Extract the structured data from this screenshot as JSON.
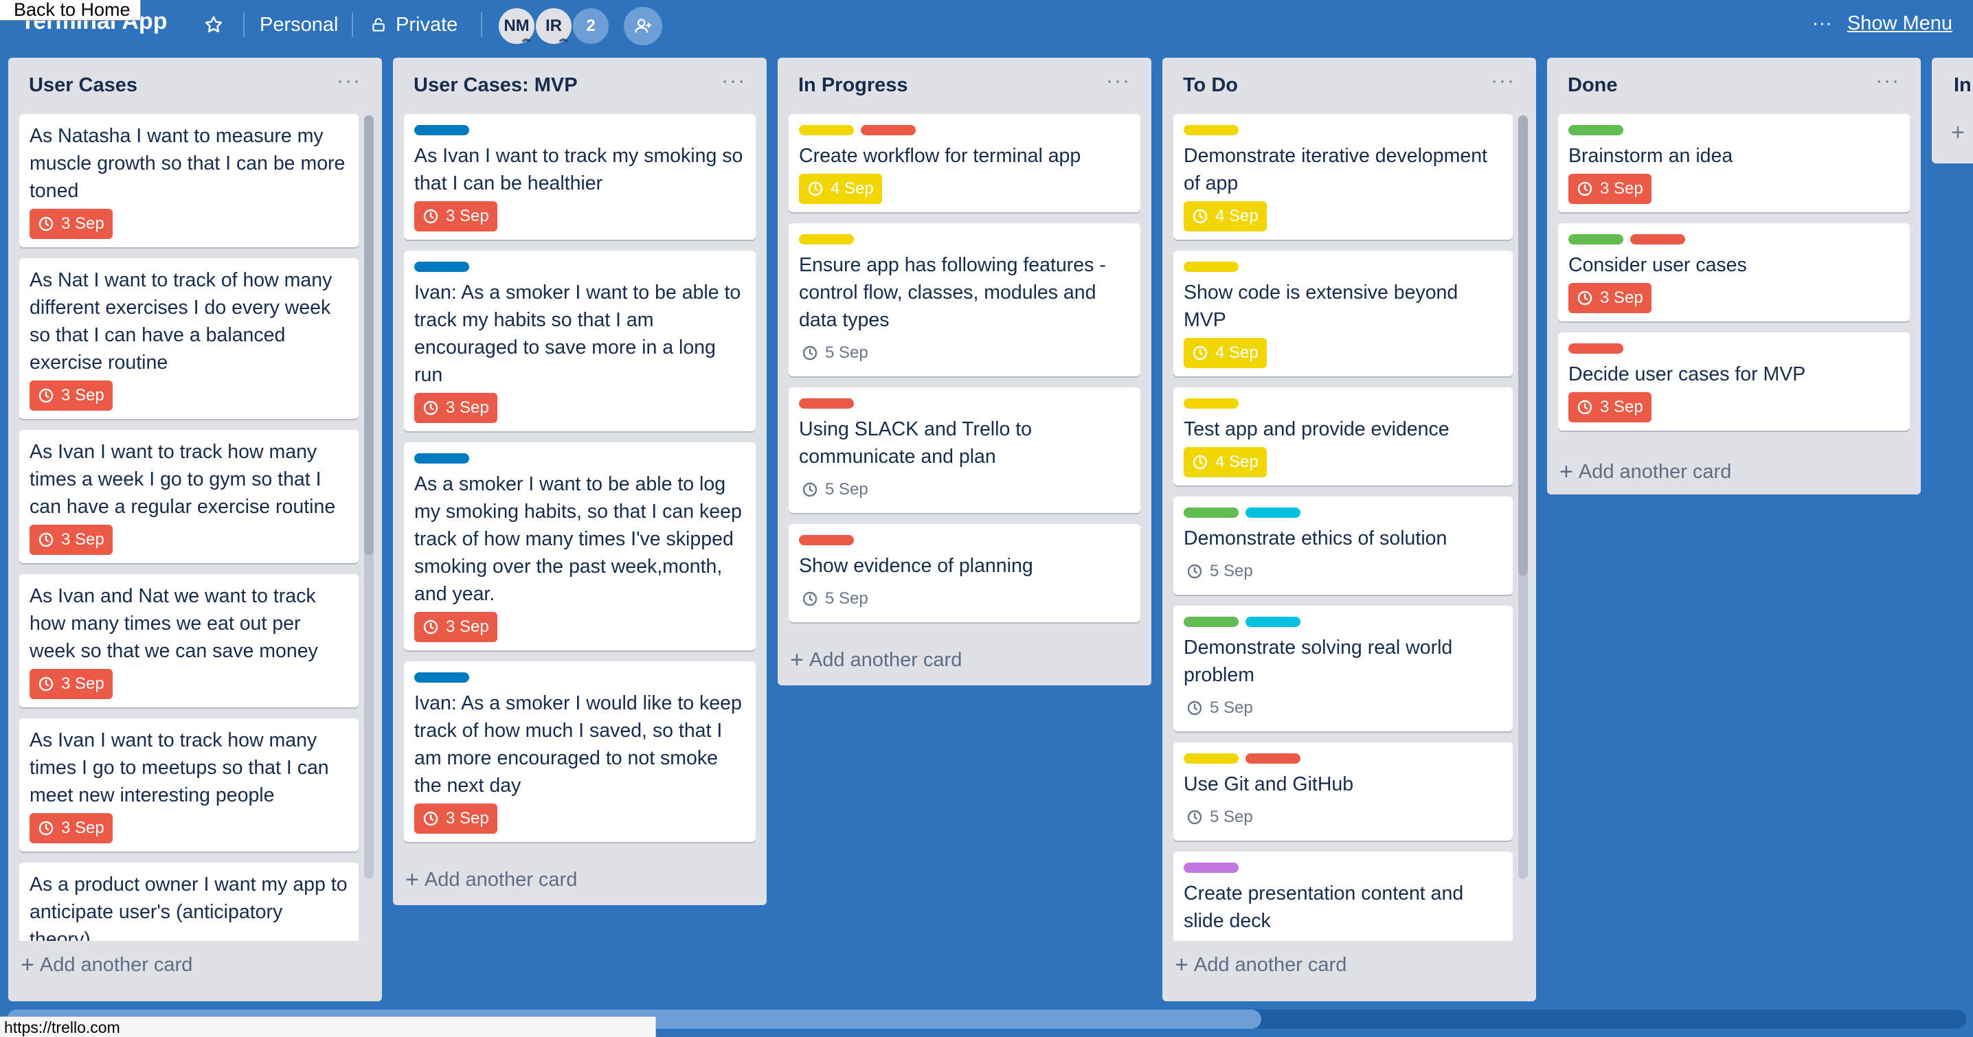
{
  "header": {
    "back_home": "Back to Home",
    "board_title": "Terminal App",
    "team": "Personal",
    "visibility": "Private",
    "members": [
      "NM",
      "IR"
    ],
    "member_count": "2",
    "show_menu_dots": "···",
    "show_menu": "Show Menu"
  },
  "colors": {
    "background": "#2f73bd",
    "red": "#eb5a46",
    "yellow": "#f2d600",
    "green": "#61bd4f",
    "blue": "#0079bf",
    "sky": "#00c2e0",
    "purple": "#c377e0"
  },
  "lists": [
    {
      "title": "User Cases",
      "menu": "···",
      "cards": [
        {
          "labels": [],
          "text": "As Natasha I want to measure my muscle growth so that I can be more toned",
          "due": "3 Sep",
          "due_style": "overdue"
        },
        {
          "labels": [],
          "text": "As Nat I want to track of how many different exercises I do every week so that I can have a balanced exercise routine",
          "due": "3 Sep",
          "due_style": "overdue"
        },
        {
          "labels": [],
          "text": "As Ivan I want to track how many times a week I go to gym so that I can have a regular exercise routine",
          "due": "3 Sep",
          "due_style": "overdue"
        },
        {
          "labels": [],
          "text": "As Ivan and Nat we want to track how many times we eat out per week so that we can save money",
          "due": "3 Sep",
          "due_style": "overdue"
        },
        {
          "labels": [],
          "text": "As Ivan I want to track how many times I go to meetups so that I can meet new interesting people",
          "due": "3 Sep",
          "due_style": "overdue"
        },
        {
          "labels": [],
          "text": "As a product owner I want my app to anticipate user's (anticipatory theory)",
          "due": "",
          "due_style": "none"
        }
      ],
      "add_card": "Add another card"
    },
    {
      "title": "User Cases: MVP",
      "menu": "···",
      "cards": [
        {
          "labels": [
            "blue"
          ],
          "text": "As Ivan I want to track my smoking so that I can be healthier",
          "due": "3 Sep",
          "due_style": "overdue"
        },
        {
          "labels": [
            "blue"
          ],
          "text": "Ivan: As a smoker I want to be able to track my habits so that I am encouraged to save more in a long run",
          "due": "3 Sep",
          "due_style": "overdue"
        },
        {
          "labels": [
            "blue"
          ],
          "text": "As a smoker I want to be able to log my smoking habits, so that I can keep track of how many times I've skipped smoking over the past week,month, and year.",
          "due": "3 Sep",
          "due_style": "overdue"
        },
        {
          "labels": [
            "blue"
          ],
          "text": "Ivan: As a smoker I would like to keep track of how much I saved, so that I am more encouraged to not smoke the next day",
          "due": "3 Sep",
          "due_style": "overdue"
        }
      ],
      "add_card": "Add another card"
    },
    {
      "title": "In Progress",
      "menu": "···",
      "cards": [
        {
          "labels": [
            "yellow",
            "red"
          ],
          "text": "Create workflow for terminal app",
          "due": "4 Sep",
          "due_style": "due-soon"
        },
        {
          "labels": [
            "yellow"
          ],
          "text": "Ensure app has following features - control flow, classes, modules and data types",
          "due": "5 Sep",
          "due_style": "plain"
        },
        {
          "labels": [
            "red"
          ],
          "text": "Using SLACK and Trello to communicate and plan",
          "due": "5 Sep",
          "due_style": "plain"
        },
        {
          "labels": [
            "red"
          ],
          "text": "Show evidence of planning",
          "due": "5 Sep",
          "due_style": "plain"
        }
      ],
      "add_card": "Add another card"
    },
    {
      "title": "To Do",
      "menu": "···",
      "cards": [
        {
          "labels": [
            "yellow"
          ],
          "text": "Demonstrate iterative development of app",
          "due": "4 Sep",
          "due_style": "due-soon"
        },
        {
          "labels": [
            "yellow"
          ],
          "text": "Show code is extensive beyond MVP",
          "due": "4 Sep",
          "due_style": "due-soon"
        },
        {
          "labels": [
            "yellow"
          ],
          "text": "Test app and provide evidence",
          "due": "4 Sep",
          "due_style": "due-soon"
        },
        {
          "labels": [
            "green",
            "sky"
          ],
          "text": "Demonstrate ethics of solution",
          "due": "5 Sep",
          "due_style": "plain"
        },
        {
          "labels": [
            "green",
            "sky"
          ],
          "text": "Demonstrate solving real world problem",
          "due": "5 Sep",
          "due_style": "plain"
        },
        {
          "labels": [
            "yellow",
            "red"
          ],
          "text": "Use Git and GitHub",
          "due": "5 Sep",
          "due_style": "plain"
        },
        {
          "labels": [
            "purple"
          ],
          "text": "Create presentation content and slide deck",
          "due": "",
          "due_style": "none"
        }
      ],
      "add_card": "Add another card"
    },
    {
      "title": "Done",
      "menu": "···",
      "cards": [
        {
          "labels": [
            "green"
          ],
          "text": "Brainstorm an idea",
          "due": "3 Sep",
          "due_style": "overdue"
        },
        {
          "labels": [
            "green",
            "red"
          ],
          "text": "Consider user cases",
          "due": "3 Sep",
          "due_style": "overdue"
        },
        {
          "labels": [
            "red"
          ],
          "text": "Decide user cases for MVP",
          "due": "3 Sep",
          "due_style": "overdue"
        }
      ],
      "add_card": "Add another card"
    },
    {
      "title": "In",
      "menu": "",
      "cards": [],
      "add_card": "+"
    }
  ],
  "status_bar": {
    "url": "https://trello.com"
  }
}
